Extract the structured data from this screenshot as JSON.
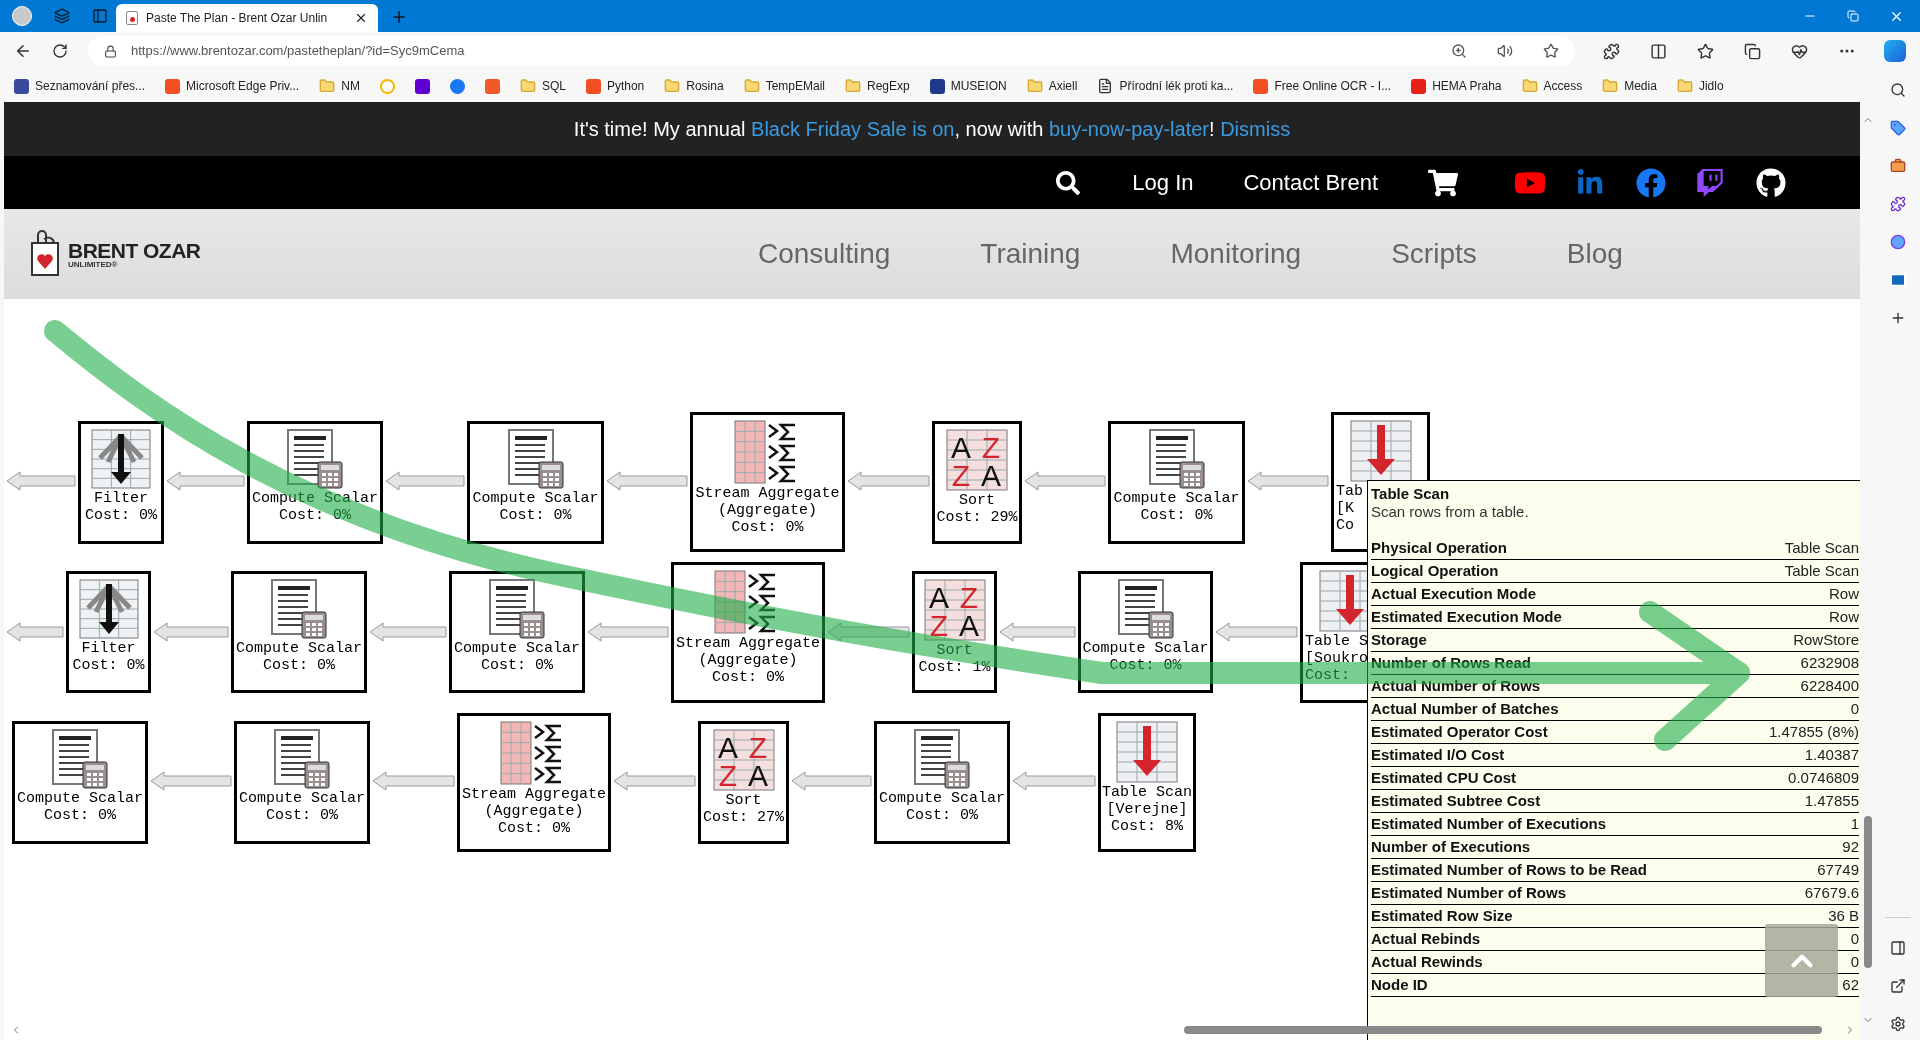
{
  "browser": {
    "tabs": [
      {
        "title": "Paste The Plan - Brent Ozar Unlin",
        "selected": true
      }
    ],
    "url": "https://www.brentozar.com/pastetheplan/?id=Syc9mCema"
  },
  "bookmarks": [
    {
      "kind": "site",
      "label": "Seznamování přes..."
    },
    {
      "kind": "site",
      "label": "Microsoft Edge Priv..."
    },
    {
      "kind": "folder",
      "label": "NM"
    },
    {
      "kind": "icon"
    },
    {
      "kind": "icon"
    },
    {
      "kind": "icon"
    },
    {
      "kind": "icon"
    },
    {
      "kind": "folder",
      "label": "SQL"
    },
    {
      "kind": "site",
      "label": "Python"
    },
    {
      "kind": "folder",
      "label": "Rosina"
    },
    {
      "kind": "folder",
      "label": "TempEMail"
    },
    {
      "kind": "folder",
      "label": "RegExp"
    },
    {
      "kind": "site",
      "label": "MUSEION"
    },
    {
      "kind": "folder",
      "label": "Axiell"
    },
    {
      "kind": "page",
      "label": "Přírodní lék proti ka..."
    },
    {
      "kind": "site",
      "label": "Free Online OCR - I..."
    },
    {
      "kind": "site",
      "label": "HEMA Praha"
    },
    {
      "kind": "folder",
      "label": "Access"
    },
    {
      "kind": "folder",
      "label": "Media"
    },
    {
      "kind": "folder",
      "label": "Jidlo"
    }
  ],
  "banner": {
    "parts": [
      {
        "kind": "text",
        "text": "It's time! My annual "
      },
      {
        "kind": "link",
        "text": "Black Friday Sale is on"
      },
      {
        "kind": "text",
        "text": ", now with "
      },
      {
        "kind": "link",
        "text": "buy-now-pay-later"
      },
      {
        "kind": "text",
        "text": "! "
      },
      {
        "kind": "link",
        "text": "Dismiss"
      }
    ]
  },
  "top_nav": {
    "links": [
      "Log In",
      "Contact Brent"
    ]
  },
  "logo": {
    "name": "BRENT OZAR",
    "tagline": "UNLIMITED®"
  },
  "menu": [
    "Consulting",
    "Training",
    "Monitoring",
    "Scripts",
    "Blog"
  ],
  "plan": {
    "rows": [
      {
        "nodes": [
          {
            "kind": "filter",
            "lines": [
              "Filter",
              "Cost: 0%"
            ]
          },
          {
            "kind": "compute-scalar",
            "lines": [
              "Compute Scalar",
              "Cost: 0%"
            ]
          },
          {
            "kind": "compute-scalar",
            "lines": [
              "Compute Scalar",
              "Cost: 0%"
            ]
          },
          {
            "kind": "stream-aggregate",
            "lines": [
              "Stream Aggregate",
              "(Aggregate)",
              "Cost: 0%"
            ]
          },
          {
            "kind": "sort",
            "icon_letters": [
              "A",
              "Z",
              "Z",
              "A"
            ],
            "lines": [
              "Sort",
              "Cost: 29%"
            ]
          },
          {
            "kind": "compute-scalar",
            "lines": [
              "Compute Scalar",
              "Cost: 0%"
            ]
          },
          {
            "kind": "table-scan",
            "lines": [
              "Tab",
              "[K",
              "Co"
            ]
          }
        ]
      },
      {
        "nodes": [
          {
            "kind": "filter",
            "lines": [
              "Filter",
              "Cost: 0%"
            ]
          },
          {
            "kind": "compute-scalar",
            "lines": [
              "Compute Scalar",
              "Cost: 0%"
            ]
          },
          {
            "kind": "compute-scalar",
            "lines": [
              "Compute Scalar",
              "Cost: 0%"
            ]
          },
          {
            "kind": "stream-aggregate",
            "lines": [
              "Stream Aggregate",
              "(Aggregate)",
              "Cost: 0%"
            ]
          },
          {
            "kind": "sort",
            "icon_letters": [
              "A",
              "Z",
              "Z",
              "A"
            ],
            "lines": [
              "Sort",
              "Cost: 1%"
            ]
          },
          {
            "kind": "compute-scalar",
            "lines": [
              "Compute Scalar",
              "Cost: 0%"
            ]
          },
          {
            "kind": "table-scan",
            "lines": [
              "Table S",
              "[Soukro",
              "Cost:"
            ]
          }
        ]
      },
      {
        "nodes": [
          {
            "kind": "compute-scalar",
            "lines": [
              "Compute Scalar",
              "Cost: 0%"
            ]
          },
          {
            "kind": "compute-scalar",
            "lines": [
              "Compute Scalar",
              "Cost: 0%"
            ]
          },
          {
            "kind": "stream-aggregate",
            "lines": [
              "Stream Aggregate",
              "(Aggregate)",
              "Cost: 0%"
            ]
          },
          {
            "kind": "sort",
            "icon_letters": [
              "A",
              "Z",
              "Z",
              "A"
            ],
            "lines": [
              "Sort",
              "Cost: 27%"
            ]
          },
          {
            "kind": "compute-scalar",
            "lines": [
              "Compute Scalar",
              "Cost: 0%"
            ]
          },
          {
            "kind": "table-scan",
            "lines": [
              "Table Scan",
              "[Verejne]",
              "Cost: 8%"
            ]
          }
        ]
      }
    ]
  },
  "tooltip": {
    "title": "Table Scan",
    "description": "Scan rows from a table.",
    "properties": [
      {
        "name": "Physical Operation",
        "value": "Table Scan"
      },
      {
        "name": "Logical Operation",
        "value": "Table Scan"
      },
      {
        "name": "Actual Execution Mode",
        "value": "Row"
      },
      {
        "name": "Estimated Execution Mode",
        "value": "Row"
      },
      {
        "name": "Storage",
        "value": "RowStore"
      },
      {
        "name": "Number of Rows Read",
        "value": "6232908"
      },
      {
        "name": "Actual Number of Rows",
        "value": "6228400"
      },
      {
        "name": "Actual Number of Batches",
        "value": "0"
      },
      {
        "name": "Estimated Operator Cost",
        "value": "1.47855 (8%)"
      },
      {
        "name": "Estimated I/O Cost",
        "value": "1.40387"
      },
      {
        "name": "Estimated CPU Cost",
        "value": "0.0746809"
      },
      {
        "name": "Estimated Subtree Cost",
        "value": "1.47855"
      },
      {
        "name": "Estimated Number of Executions",
        "value": "1"
      },
      {
        "name": "Number of Executions",
        "value": "92"
      },
      {
        "name": "Estimated Number of Rows to be Read",
        "value": "67749"
      },
      {
        "name": "Estimated Number of Rows",
        "value": "67679.6"
      },
      {
        "name": "Estimated Row Size",
        "value": "36 B"
      },
      {
        "name": "Actual Rebinds",
        "value": "0"
      },
      {
        "name": "Actual Rewinds",
        "value": "0"
      },
      {
        "name": "Node ID",
        "value": "62"
      }
    ]
  }
}
